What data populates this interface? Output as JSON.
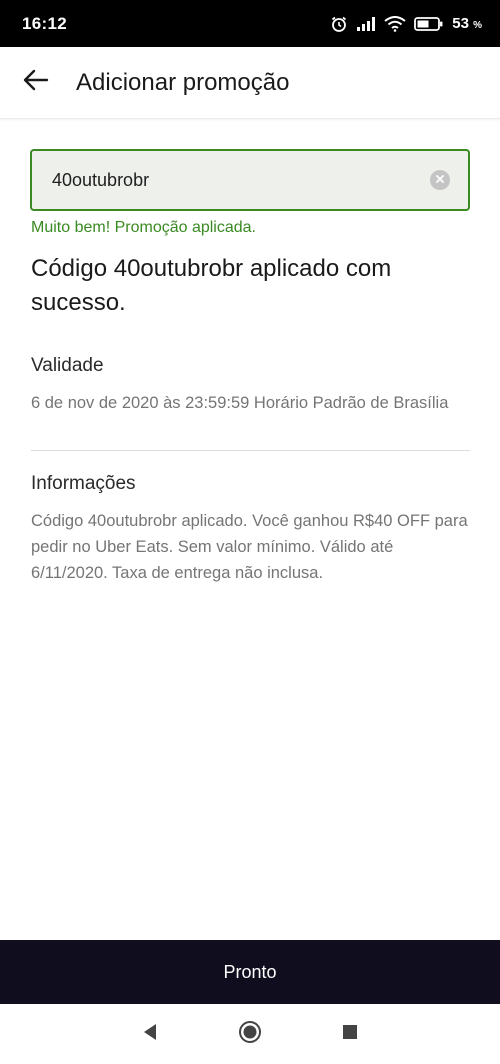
{
  "status_bar": {
    "time": "16:12",
    "battery_percent": "53",
    "battery_unit": "%",
    "icons": [
      "alarm-icon",
      "signal-icon",
      "wifi-icon",
      "battery-icon"
    ]
  },
  "app_bar": {
    "back_icon": "arrow-left-icon",
    "title": "Adicionar promoção"
  },
  "promo": {
    "input_value": "40outubrobr",
    "clear_icon": "clear-icon",
    "success_message": "Muito bem! Promoção aplicada.",
    "headline": "Código 40outubrobr aplicado com sucesso."
  },
  "validity": {
    "label": "Validade",
    "text": "6 de nov de 2020 às 23:59:59 Horário Padrão de Brasília"
  },
  "info": {
    "label": "Informações",
    "text": "Código 40outubrobr aplicado. Você ganhou R$40 OFF para pedir no Uber Eats. Sem valor mínimo. Válido até 6/11/2020. Taxa de entrega não inclusa."
  },
  "footer": {
    "button_label": "Pronto"
  },
  "nav_bar": {
    "icons": [
      "back-triangle-icon",
      "home-circle-icon",
      "recents-square-icon"
    ]
  },
  "colors": {
    "success_green": "#3a8a23",
    "button_dark": "#0f0d1e",
    "input_bg": "#eef0ec",
    "muted_text": "#757575"
  }
}
